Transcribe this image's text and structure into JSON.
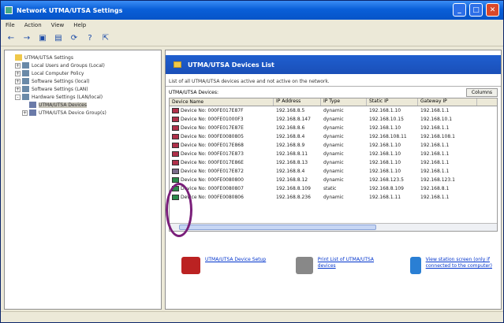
{
  "window": {
    "title": "Network UTMA/UTSA Settings"
  },
  "menu": [
    "File",
    "Action",
    "View",
    "Help"
  ],
  "toolbar_icons": [
    "back-icon",
    "forward-icon",
    "console-icon",
    "properties-icon",
    "refresh-icon",
    "help-icon",
    "export-icon"
  ],
  "tree": [
    {
      "label": "UTMA/UTSA Settings",
      "level": 0,
      "exp": ""
    },
    {
      "label": "Local Users and Groups (Local)",
      "level": 1,
      "exp": "+"
    },
    {
      "label": "Local Computer Policy",
      "level": 1,
      "exp": "+"
    },
    {
      "label": "Software Settings (local)",
      "level": 1,
      "exp": "+"
    },
    {
      "label": "Software Settings (LAN)",
      "level": 1,
      "exp": "+"
    },
    {
      "label": "Hardware Settings (LAN/local)",
      "level": 1,
      "exp": "-"
    },
    {
      "label": "UTMA/UTSA Devices",
      "level": 2,
      "exp": "",
      "selected": true
    },
    {
      "label": "UTMA/UTSA Device Group(s)",
      "level": 2,
      "exp": "+"
    }
  ],
  "panel": {
    "banner": "UTMA/UTSA Devices List",
    "description": "List of all UTMA/UTSA devices active and not active on the network.",
    "list_title": "UTMA/UTSA Devices:",
    "columns_button": "Columns"
  },
  "columns": [
    "Device Name",
    "IP Address",
    "IP Type",
    "Static IP",
    "Gateway IP"
  ],
  "rows": [
    [
      "Device No: 000FE017E87F",
      "192.168.8.5",
      "dynamic",
      "192.168.1.10",
      "192.168.1.1"
    ],
    [
      "Device No: 000FE01000F3",
      "192.168.8.147",
      "dynamic",
      "192.168.10.15",
      "192.168.10.1"
    ],
    [
      "Device No: 000FE017E87E",
      "192.168.8.6",
      "dynamic",
      "192.168.1.10",
      "192.168.1.1"
    ],
    [
      "Device No: 000FE0080805",
      "192.168.8.4",
      "dynamic",
      "192.168.108.11",
      "192.168.108.1"
    ],
    [
      "Device No: 000FE017E868",
      "192.168.8.9",
      "dynamic",
      "192.168.1.10",
      "192.168.1.1"
    ],
    [
      "Device No: 000FE017E873",
      "192.168.8.11",
      "dynamic",
      "192.168.1.10",
      "192.168.1.1"
    ],
    [
      "Device No: 000FE017E86E",
      "192.168.8.13",
      "dynamic",
      "192.168.1.10",
      "192.168.1.1"
    ],
    [
      "Device No: 000FE017E872",
      "192.168.8.4",
      "dynamic",
      "192.168.1.10",
      "192.168.1.1"
    ],
    [
      "Device No: 000FE0080800",
      "192.168.8.12",
      "dynamic",
      "192.168.123.5",
      "192.168.123.1"
    ],
    [
      "Device No: 000FE0080807",
      "192.168.8.109",
      "static",
      "192.168.8.109",
      "192.168.8.1"
    ],
    [
      "Device No: 000FE0080806",
      "192.168.8.236",
      "dynamic",
      "192.168.1.11",
      "192.168.1.1"
    ]
  ],
  "row_icon_colors": [
    "#b0304a",
    "#b0304a",
    "#b0304a",
    "#b0304a",
    "#b0304a",
    "#b0304a",
    "#b0304a",
    "#7a6a8a",
    "#2a8a4a",
    "#2a8a4a",
    "#2a8a4a"
  ],
  "links": [
    {
      "label": "UTMA/UTSA Device Setup",
      "icon": "device-setup-icon",
      "color": "#b22"
    },
    {
      "label": "Print List of UTMA/UTSA devices",
      "icon": "printer-icon",
      "color": "#888"
    },
    {
      "label": "View station screen (only if connected to the computer)",
      "icon": "globe-icon",
      "color": "#2a7fd4"
    }
  ],
  "annotation_color": "#7a1f7a"
}
